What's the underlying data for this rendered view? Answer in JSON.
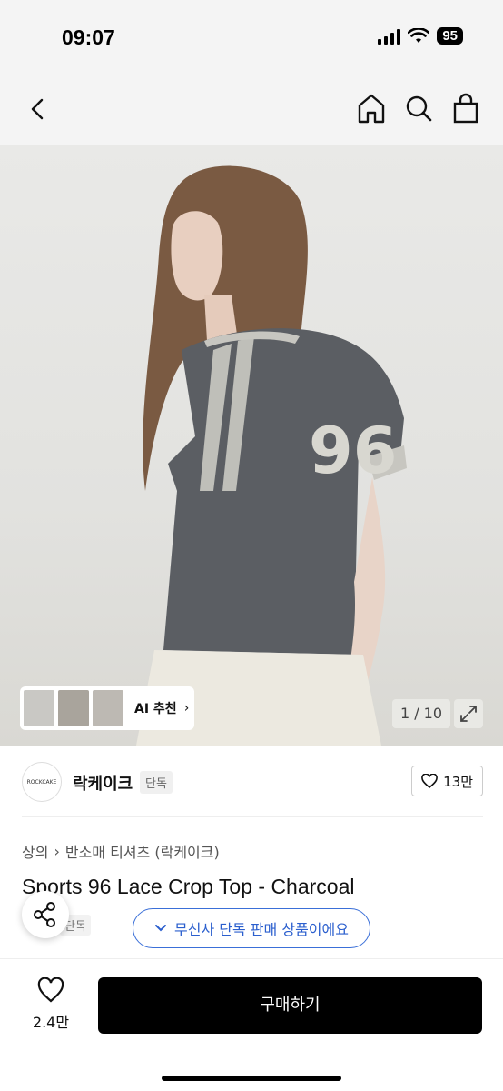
{
  "status": {
    "time": "09:07",
    "battery": "95"
  },
  "nav": {
    "back_icon": "chevron-left-icon",
    "icons": [
      "home-icon",
      "search-icon",
      "bag-icon"
    ]
  },
  "gallery": {
    "counter": "1 / 10",
    "ai_label": "AI 추천",
    "jersey_number": "96"
  },
  "brand": {
    "logo_text": "ROCKCAKE",
    "name": "락케이크",
    "tag": "단독",
    "likes": "13만"
  },
  "breadcrumb": {
    "level1": "상의",
    "level2": "반소매 티셔츠 (락케이크)"
  },
  "product": {
    "title": "Sports 96 Lace Crop Top - Charcoal",
    "tag": "단독"
  },
  "banner": {
    "text": "무신사 단독 판매 상품이에요"
  },
  "bottom": {
    "wish_count": "2.4만",
    "buy_label": "구매하기"
  },
  "colors": {
    "accent": "#2b5fce",
    "primary": "#000000"
  }
}
